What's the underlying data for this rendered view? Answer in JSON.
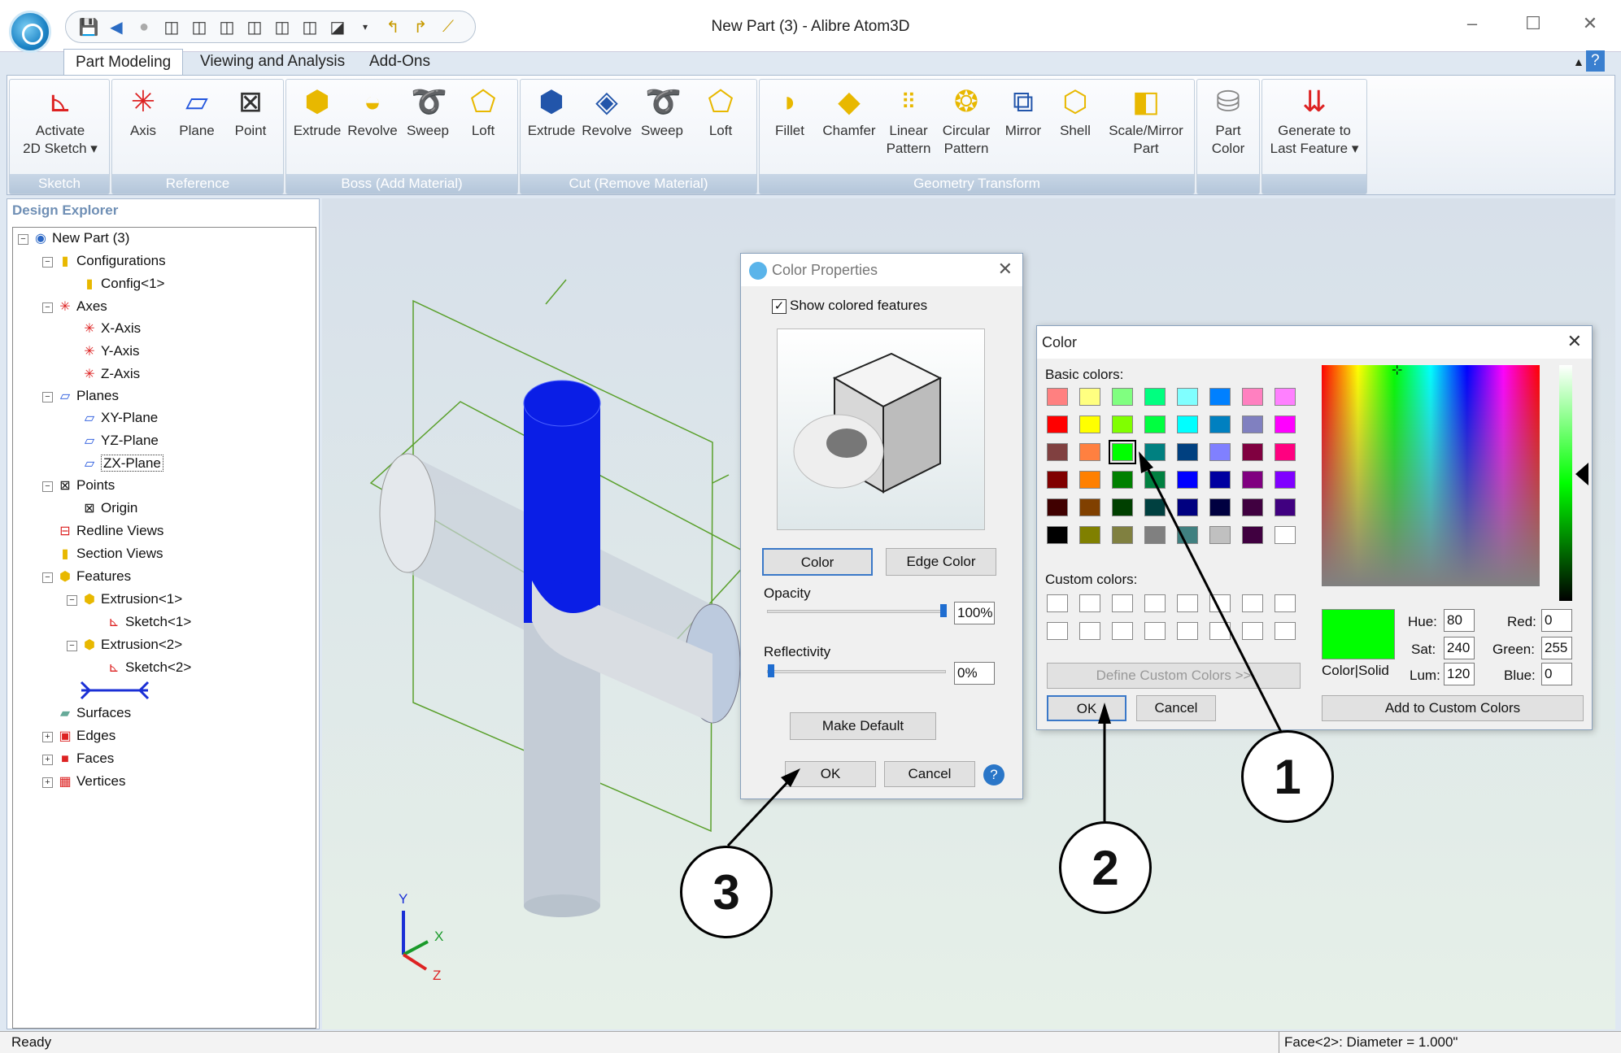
{
  "window": {
    "title": "New Part (3) - Alibre Atom3D"
  },
  "tabs": [
    "Part Modeling",
    "Viewing and Analysis",
    "Add-Ons"
  ],
  "ribbon": {
    "sketch": {
      "label": "Sketch",
      "activate": "Activate",
      "activate2": "2D Sketch"
    },
    "reference": {
      "label": "Reference",
      "axis": "Axis",
      "plane": "Plane",
      "point": "Point"
    },
    "boss": {
      "label": "Boss (Add Material)",
      "extrude": "Extrude",
      "revolve": "Revolve",
      "sweep": "Sweep",
      "loft": "Loft"
    },
    "cut": {
      "label": "Cut (Remove Material)",
      "extrude": "Extrude",
      "revolve": "Revolve",
      "sweep": "Sweep",
      "loft": "Loft"
    },
    "geom": {
      "label": "Geometry Transform",
      "fillet": "Fillet",
      "chamfer": "Chamfer",
      "linear1": "Linear",
      "linear2": "Pattern",
      "circular1": "Circular",
      "circular2": "Pattern",
      "mirror": "Mirror",
      "shell": "Shell",
      "scale1": "Scale/Mirror",
      "scale2": "Part"
    },
    "partcolor": {
      "l1": "Part",
      "l2": "Color"
    },
    "generate": {
      "l1": "Generate to",
      "l2": "Last Feature"
    }
  },
  "explorer": {
    "title": "Design Explorer",
    "nodes": [
      "New Part (3)",
      "Configurations",
      "Config<1>",
      "Axes",
      "X-Axis",
      "Y-Axis",
      "Z-Axis",
      "Planes",
      "XY-Plane",
      "YZ-Plane",
      "ZX-Plane",
      "Points",
      "Origin",
      "Redline Views",
      "Section Views",
      "Features",
      "Extrusion<1>",
      "Sketch<1>",
      "Extrusion<2>",
      "Sketch<2>",
      "Surfaces",
      "Edges",
      "Faces",
      "Vertices"
    ]
  },
  "color_properties": {
    "title": "Color Properties",
    "show_colored": "Show colored features",
    "color_btn": "Color",
    "edge_btn": "Edge Color",
    "opacity_label": "Opacity",
    "opacity_value": "100%",
    "opacity_level": 1.0,
    "reflectivity_label": "Reflectivity",
    "reflectivity_value": "0%",
    "reflectivity_level": 0.0,
    "make_default": "Make Default",
    "ok": "OK",
    "cancel": "Cancel"
  },
  "color_dialog": {
    "title": "Color",
    "basic_label": "Basic colors:",
    "custom_label": "Custom colors:",
    "define_custom": "Define Custom Colors >>",
    "ok": "OK",
    "cancel": "Cancel",
    "color_solid": "Color|Solid",
    "hue_label": "Hue:",
    "hue": "80",
    "sat_label": "Sat:",
    "sat": "240",
    "lum_label": "Lum:",
    "lum": "120",
    "red_label": "Red:",
    "red": "0",
    "green_label": "Green:",
    "green": "255",
    "blue_label": "Blue:",
    "blue": "0",
    "add_custom": "Add to Custom Colors",
    "selected_color": "#00ff00",
    "swatches": [
      [
        "#ff8080",
        "#ffff80",
        "#80ff80",
        "#00ff80",
        "#80ffff",
        "#0080ff",
        "#ff80c0",
        "#ff80ff"
      ],
      [
        "#ff0000",
        "#ffff00",
        "#80ff00",
        "#00ff40",
        "#00ffff",
        "#0080c0",
        "#8080c0",
        "#ff00ff"
      ],
      [
        "#804040",
        "#ff8040",
        "#00ff00",
        "#008080",
        "#004080",
        "#8080ff",
        "#800040",
        "#ff0080"
      ],
      [
        "#800000",
        "#ff8000",
        "#008000",
        "#008040",
        "#0000ff",
        "#0000a0",
        "#800080",
        "#8000ff"
      ],
      [
        "#400000",
        "#804000",
        "#004000",
        "#004040",
        "#000080",
        "#000040",
        "#400040",
        "#400080"
      ],
      [
        "#000000",
        "#808000",
        "#808040",
        "#808080",
        "#408080",
        "#c0c0c0",
        "#400040",
        "#ffffff"
      ]
    ]
  },
  "callouts": [
    "1",
    "2",
    "3"
  ],
  "status": {
    "left": "Ready",
    "right": "Face<2>: Diameter = 1.000\""
  },
  "triad": {
    "x": "X",
    "y": "Y",
    "z": "Z"
  }
}
